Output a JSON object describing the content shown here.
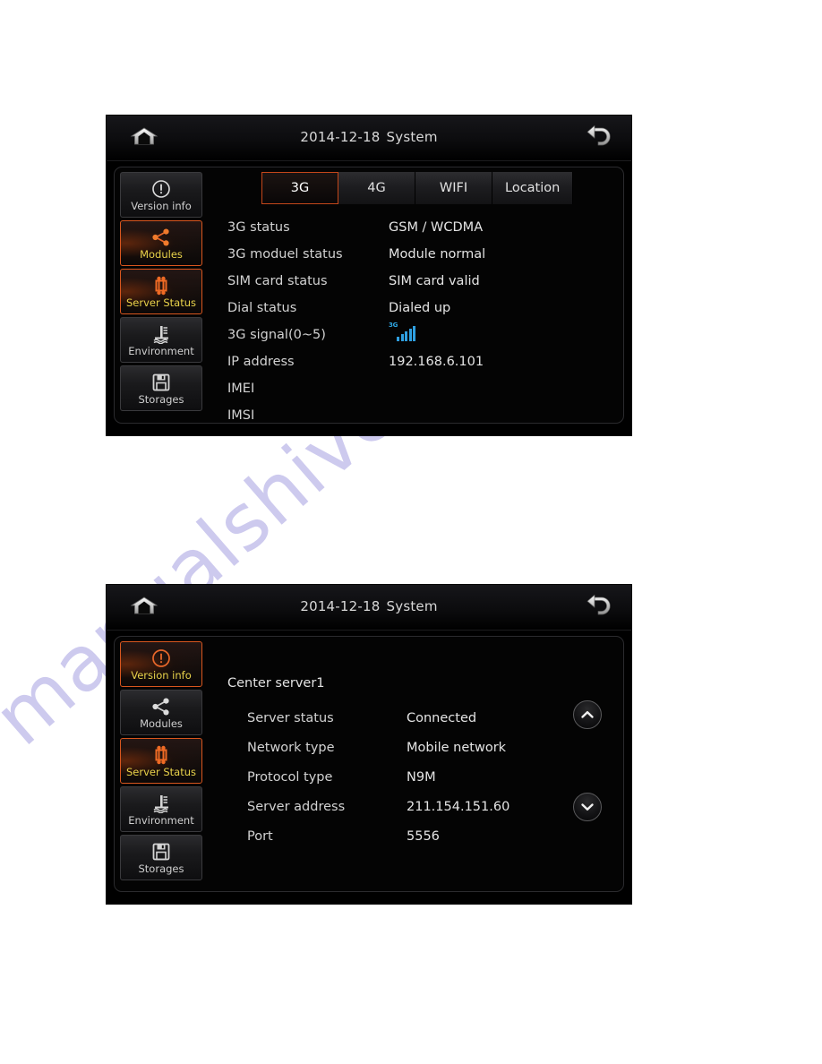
{
  "page": {
    "watermark": "manualshive.com",
    "background": "#ffffff"
  },
  "colors": {
    "accent_orange": "#d8561e",
    "active_label": "#e8d24a",
    "signal_blue": "#2f9fe0",
    "panel_background": "#000000",
    "text_primary": "#e4e4e4"
  },
  "panel1": {
    "titlebar": {
      "home_icon": "home-icon",
      "back_icon": "back-arrow-icon",
      "date": "2014-12-18",
      "title": "System"
    },
    "sidebar": [
      {
        "label": "Version info",
        "icon": "exclamation-circle-icon",
        "active": false
      },
      {
        "label": "Modules",
        "icon": "share-nodes-icon",
        "active": true
      },
      {
        "label": "Server Status",
        "icon": "network-grid-icon",
        "active": true
      },
      {
        "label": "Environment",
        "icon": "thermometer-icon",
        "active": false
      },
      {
        "label": "Storages",
        "icon": "floppy-disk-icon",
        "active": false
      }
    ],
    "tabs": [
      {
        "label": "3G",
        "active": true
      },
      {
        "label": "4G",
        "active": false
      },
      {
        "label": "WIFI",
        "active": false
      },
      {
        "label": "Location",
        "active": false
      }
    ],
    "rows": [
      {
        "key": "3G status",
        "value": "GSM / WCDMA"
      },
      {
        "key": "3G moduel status",
        "value": "Module normal"
      },
      {
        "key": "SIM card status",
        "value": "SIM card valid"
      },
      {
        "key": "Dial status",
        "value": "Dialed up"
      },
      {
        "key": "3G signal(0~5)",
        "value": "",
        "icon": "signal-bars-icon",
        "signal_label": "3G",
        "signal_bars": 5
      },
      {
        "key": "IP address",
        "value": "192.168.6.101"
      },
      {
        "key": "IMEI",
        "value": ""
      },
      {
        "key": "IMSI",
        "value": ""
      }
    ]
  },
  "panel2": {
    "titlebar": {
      "home_icon": "home-icon",
      "back_icon": "back-arrow-icon",
      "date": "2014-12-18",
      "title": "System"
    },
    "sidebar": [
      {
        "label": "Version info",
        "icon": "exclamation-circle-icon",
        "active": true
      },
      {
        "label": "Modules",
        "icon": "share-nodes-icon",
        "active": false
      },
      {
        "label": "Server Status",
        "icon": "network-grid-icon",
        "active": true
      },
      {
        "label": "Environment",
        "icon": "thermometer-icon",
        "active": false
      },
      {
        "label": "Storages",
        "icon": "floppy-disk-icon",
        "active": false
      }
    ],
    "group_title": "Center server1",
    "rows": [
      {
        "key": "Server status",
        "value": "Connected"
      },
      {
        "key": "Network type",
        "value": "Mobile network"
      },
      {
        "key": "Protocol type",
        "value": "N9M"
      },
      {
        "key": "Server address",
        "value": "211.154.151.60"
      },
      {
        "key": "Port",
        "value": "5556"
      }
    ],
    "scroll": {
      "up_icon": "chevron-up-icon",
      "down_icon": "chevron-down-icon"
    }
  }
}
